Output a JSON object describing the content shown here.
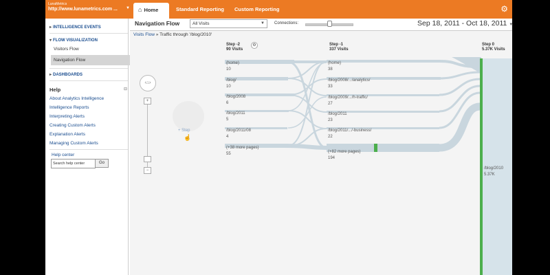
{
  "account": {
    "name": "LunaMetrics",
    "url": "http://www.lunametrics.com ..."
  },
  "tabs": {
    "home": "Home",
    "standard": "Standard Reporting",
    "custom": "Custom Reporting"
  },
  "sidebar": {
    "intelligence_events": "INTELLIGENCE EVENTS",
    "flow_visualization": "FLOW VISUALIZATION",
    "visitors_flow": "Visitors Flow",
    "navigation_flow": "Navigation Flow",
    "dashboards": "DASHBOARDS",
    "help": {
      "title": "Help",
      "links": [
        "About Analytics Intelligence",
        "Intelligence Reports",
        "Interpreting Alerts",
        "Creating Custom Alerts",
        "Explanation Alerts",
        "Managing Custom Alerts"
      ],
      "center_label": "Help center",
      "search_placeholder": "Search help center",
      "go": "Go"
    }
  },
  "main": {
    "title": "Navigation Flow",
    "segment": "All Visits",
    "connections_label": "Connections:",
    "connections_level": 0.5,
    "date_range": "Sep 18, 2011 - Oct 18, 2011",
    "breadcrumb": {
      "link": "Visits Flow",
      "rest": "» Traffic through '/blog/2010'"
    },
    "add_step": "+ Step"
  },
  "steps": [
    {
      "title": "Step -2",
      "visits": "90 Visits",
      "nodes": [
        {
          "label": "(home)",
          "value": "10"
        },
        {
          "label": "/blog/",
          "value": "10"
        },
        {
          "label": "/blog/2008",
          "value": "6"
        },
        {
          "label": "/blog/2011",
          "value": "5"
        },
        {
          "label": "/blog/2011/08",
          "value": "4"
        },
        {
          "label": "(+38 more pages)",
          "value": "55"
        }
      ]
    },
    {
      "title": "Step -1",
      "visits": "337 Visits",
      "nodes": [
        {
          "label": "(home)",
          "value": "38"
        },
        {
          "label": "/blog/2008/.../analytics/",
          "value": "33"
        },
        {
          "label": "/blog/2009/.../h-traffic/",
          "value": "27"
        },
        {
          "label": "/blog/2011",
          "value": "23"
        },
        {
          "label": "/blog/2011/.../-business/",
          "value": "22"
        },
        {
          "label": "(+82 more pages)",
          "value": "194"
        }
      ]
    },
    {
      "title": "Step 0",
      "visits": "5.37K Visits",
      "nodes": [
        {
          "label": "/blog/2010",
          "value": "5.37K"
        }
      ]
    }
  ],
  "colors": {
    "brand": "#ec7a23",
    "link": "#1a4d8f",
    "flow": "#c9d6de",
    "node_green": "#4cae4c",
    "exit_red": "#ee6a4b"
  }
}
